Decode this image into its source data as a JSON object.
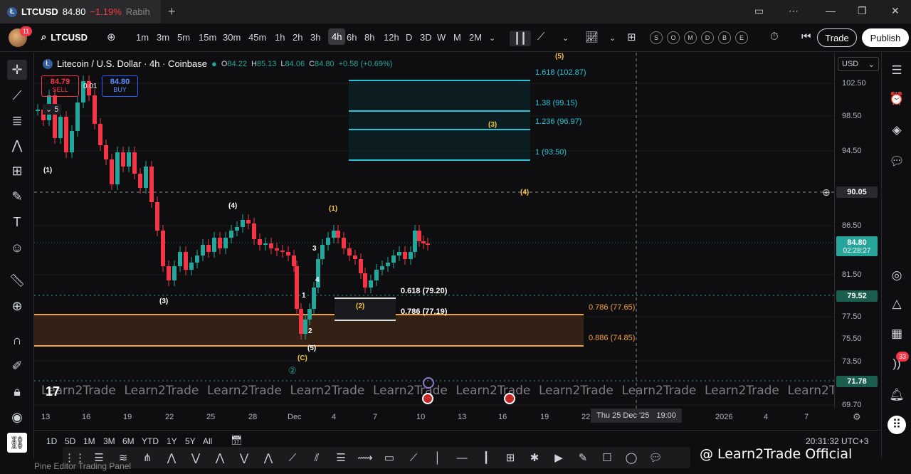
{
  "tab": {
    "symbol": "LTCUSD",
    "price": "84.80",
    "change": "−1.19%",
    "user": "Rabih"
  },
  "header": {
    "avatar_badge": "11",
    "symbol": "LTCUSD",
    "timeframes": [
      "1m",
      "3m",
      "5m",
      "15m",
      "30m",
      "45m",
      "1h",
      "2h",
      "3h",
      "4h",
      "6h",
      "8h",
      "12h",
      "D",
      "3D",
      "W",
      "M",
      "2M"
    ],
    "active_timeframe": "4h",
    "circle_buttons": [
      "S",
      "O",
      "M",
      "D",
      "B",
      "E"
    ],
    "trade_label": "Trade",
    "publish_label": "Publish"
  },
  "legend": {
    "title": "Litecoin / U.S. Dollar · 4h · Coinbase",
    "o_label": "O",
    "o": "84.22",
    "h_label": "H",
    "h": "85.13",
    "l_label": "L",
    "l": "84.06",
    "c_label": "C",
    "c": "84.80",
    "chg": "+0.58 (+0.69%)",
    "sell_price": "84.79",
    "sell_label": "SELL",
    "spread": "0.01",
    "buy_price": "84.80",
    "buy_label": "BUY",
    "indicators_count": "5"
  },
  "price_axis": {
    "currency": "USD",
    "labels": [
      "102.50",
      "98.50",
      "94.50",
      "86.50",
      "81.50",
      "77.50",
      "75.50",
      "73.50",
      "69.70"
    ],
    "crosshair_price": "90.05",
    "current_price": "84.80",
    "countdown": "02:28:27",
    "level_7952": "79.52",
    "level_7178": "71.78"
  },
  "time_axis": {
    "labels": [
      "13",
      "16",
      "19",
      "22",
      "25",
      "28",
      "Dec",
      "4",
      "7",
      "10",
      "13",
      "16",
      "19",
      "22",
      "2026",
      "4",
      "7"
    ],
    "crosshair_time": "Thu 25 Dec '25",
    "crosshair_hour": "19:00"
  },
  "annotations": {
    "fib_ext": [
      "1.618 (102.87)",
      "1.38 (99.15)",
      "1.236 (96.97)",
      "1 (93.50)"
    ],
    "fib_ret_white": [
      "0.618 (79.20)",
      "0.786 (77.19)"
    ],
    "fib_ret_orange": [
      "0.786 (77.65)",
      "0.886 (74.85)"
    ],
    "waves": {
      "w1": "(1)",
      "w3": "(3)",
      "w4": "(4)",
      "w5top": "(5)",
      "wA": "(1)",
      "w2": "(2)",
      "w3y": "(3)",
      "w4y": "(4)",
      "wC": "(C)",
      "wB5": "(5)",
      "c2": "②",
      "i1": "1",
      "i2": "2",
      "i3": "3",
      "i4": "4"
    },
    "watermark": "Learn2Trade"
  },
  "bottom": {
    "ranges": [
      "1D",
      "5D",
      "1M",
      "3M",
      "6M",
      "YTD",
      "1Y",
      "5Y",
      "All"
    ],
    "clock": "20:31:32 UTC+3",
    "brand": "@ Learn2Trade Official",
    "panel_labels": "Pine Editor      Trading Panel"
  },
  "right_toolbar": {
    "notif_badge": "33"
  },
  "colors": {
    "up": "#26a69a",
    "down": "#f23645",
    "fib_ext": "#26c6da",
    "fib_orange": "#f7a23b",
    "wave_yellow": "#f5c542",
    "current_price_tag": "#26a69a",
    "accent_blue": "#2962ff"
  }
}
